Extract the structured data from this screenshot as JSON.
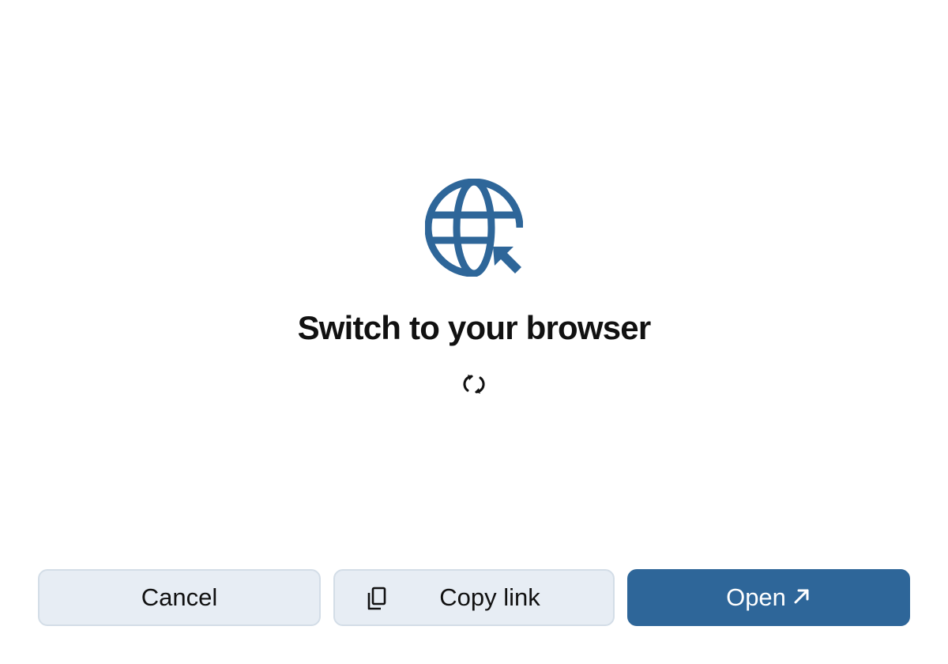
{
  "dialog": {
    "title": "Switch to your browser",
    "hero_icon": "globe-cursor-icon",
    "loading_icon": "refresh-spinner-icon"
  },
  "buttons": {
    "cancel_label": "Cancel",
    "copy_label": "Copy link",
    "copy_icon": "copy-icon",
    "open_label": "Open",
    "open_icon": "arrow-up-right-icon"
  },
  "colors": {
    "accent": "#2e6699",
    "secondary_bg": "#e7edf4",
    "secondary_border": "#d3dde7",
    "text": "#111111"
  }
}
